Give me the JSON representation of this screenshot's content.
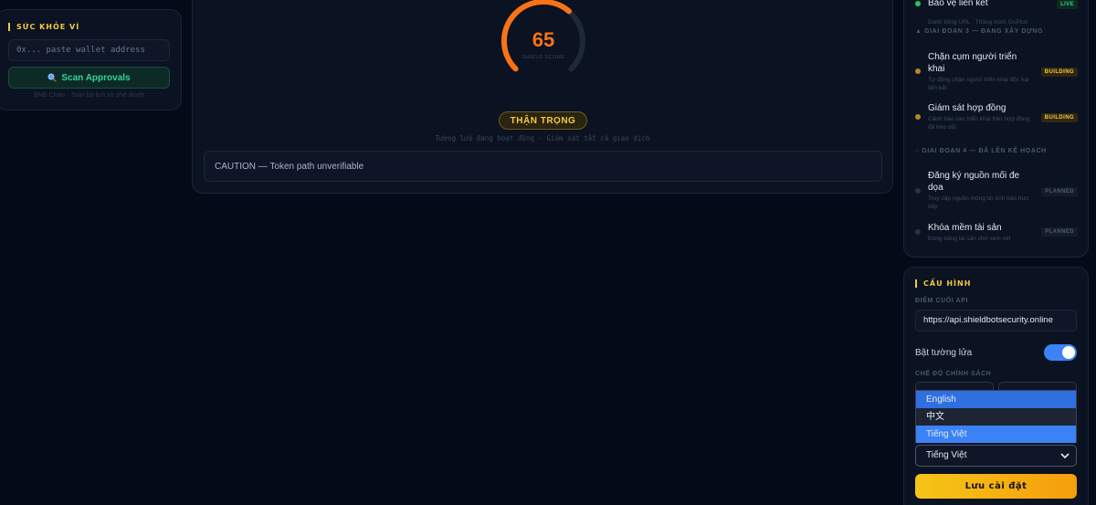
{
  "wallet_health": {
    "title": "Sức khỏe ví",
    "address_placeholder": "0x... paste wallet address",
    "scan_button": "Scan Approvals",
    "scan_icon": "magnifier-icon",
    "note": "BNB Chain · Toàn bộ lịch sử phê duyệt"
  },
  "shield": {
    "score": "65",
    "score_fraction": 0.65,
    "score_label": "SHIELD SCORE",
    "status": "THẬN TRỌNG",
    "status_subtitle": "Tường lửa đang hoạt động · Giám sát tất cả giao dịch",
    "caution": "CAUTION — Token path unverifiable",
    "colors": {
      "gauge": "#f97316",
      "track": "#1f2838",
      "status": "#f5c842"
    }
  },
  "roadmap": {
    "top_item": {
      "title": "Bảo vệ liên kết",
      "desc": "Danh tiếng URL · Thông minh GoPlus",
      "badge": "LIVE"
    },
    "phase3": {
      "label": "Giai đoạn 3 — Đang xây dựng",
      "items": [
        {
          "title": "Chặn cụm người triển khai",
          "desc": "Tự động chặn người triển khai độc hại liên kết",
          "badge": "BUILDING"
        },
        {
          "title": "Giám sát hợp đồng",
          "desc": "Cảnh báo sau triển khai trên hợp đồng đã treo dõi",
          "badge": "BUILDING"
        }
      ]
    },
    "phase4": {
      "label": "Giai đoạn 4 — Đã lên kế hoạch",
      "items": [
        {
          "title": "Đăng ký nguồn mối đe dọa",
          "desc": "Truy cập nguồn thông tin tình báo trực tiếp",
          "badge": "PLANNED"
        },
        {
          "title": "Khóa mềm tài sản",
          "desc": "Đóng băng tài sản chờ xem xét",
          "badge": "PLANNED"
        }
      ]
    }
  },
  "config": {
    "title": "Cấu hình",
    "api_label": "Điểm cuối API",
    "api_value": "https://api.shieldbotsecurity.online",
    "firewall_label": "Bật tường lửa",
    "firewall_enabled": true,
    "policy_label": "Chế độ chính sách",
    "language_options": [
      "English",
      "中文",
      "Tiếng Việt"
    ],
    "language_selected": "Tiếng Việt",
    "save_button": "Lưu cài đặt"
  }
}
